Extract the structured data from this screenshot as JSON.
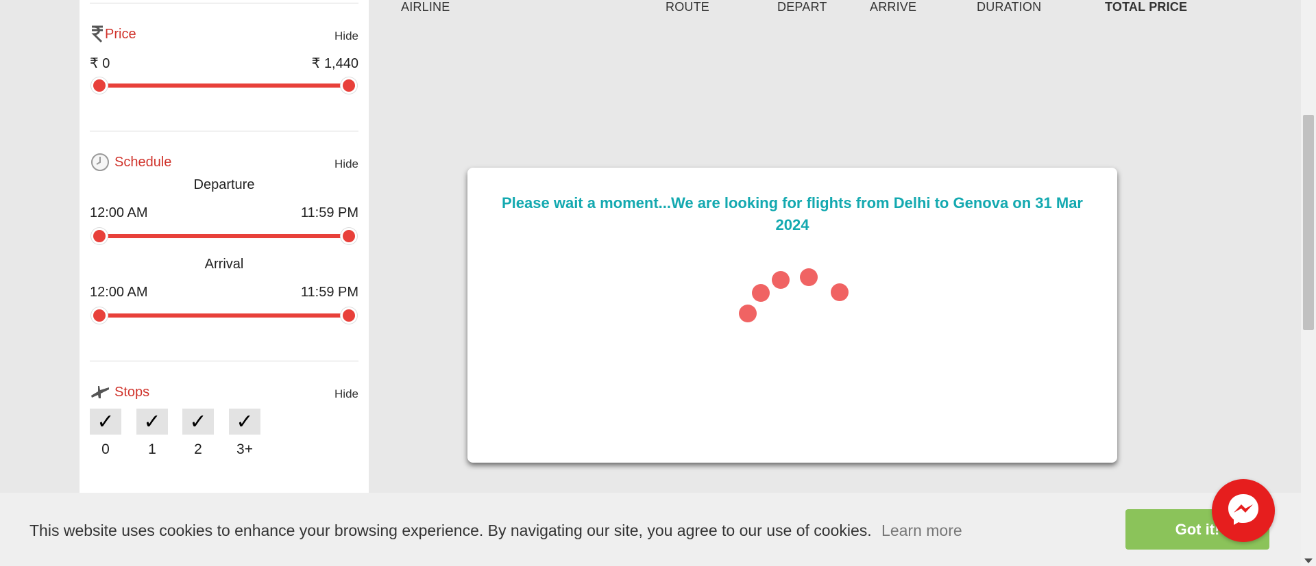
{
  "filters": {
    "price": {
      "title": "Price",
      "hide_label": "Hide",
      "min_label": "₹ 0",
      "max_label": "₹ 1,440",
      "range_fraction": [
        0,
        1
      ]
    },
    "schedule": {
      "title": "Schedule",
      "hide_label": "Hide",
      "departure": {
        "label": "Departure",
        "min": "12:00 AM",
        "max": "11:59 PM"
      },
      "arrival": {
        "label": "Arrival",
        "min": "12:00 AM",
        "max": "11:59 PM"
      }
    },
    "stops": {
      "title": "Stops",
      "hide_label": "Hide",
      "options": [
        {
          "label": "0",
          "mark": "✓"
        },
        {
          "label": "1",
          "mark": "✓"
        },
        {
          "label": "2",
          "mark": "✓"
        },
        {
          "label": "3+",
          "mark": "✓"
        }
      ]
    }
  },
  "results_header": {
    "airline": "AIRLINE",
    "route": "ROUTE",
    "depart": "DEPART",
    "arrive": "ARRIVE",
    "duration": "DURATION",
    "total_price": "TOTAL PRICE"
  },
  "loading_modal": {
    "message": "Please wait a moment...We are looking for flights from Delhi to Genova on 31 Mar 2024"
  },
  "cookie_bar": {
    "text": "This website uses cookies to enhance your browsing experience. By navigating our site, you agree to our use of cookies.",
    "learn_more": "Learn more",
    "accept_label": "Got it!"
  },
  "colors": {
    "accent_red": "#e8403a",
    "title_red": "#d0342c",
    "loading_teal": "#14a9b0",
    "cookie_green": "#8bc35a",
    "messenger_red": "#e61e1e"
  },
  "icons": {
    "price": "rupee-icon",
    "schedule": "clock-icon",
    "stops": "plane-stops-icon",
    "messenger": "messenger-icon"
  }
}
